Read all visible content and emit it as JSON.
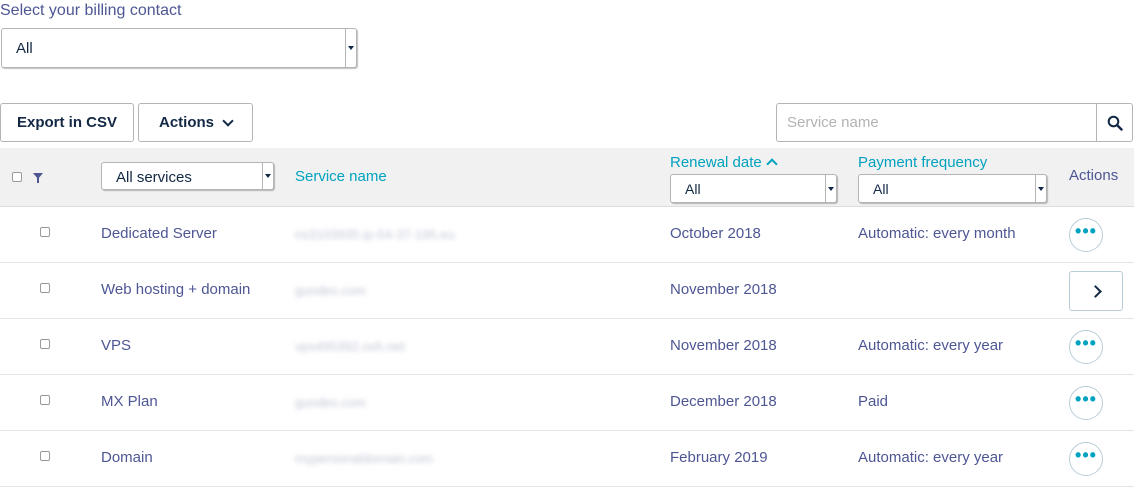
{
  "billing": {
    "label": "Select your billing contact",
    "selected": "All"
  },
  "toolbar": {
    "export_label": "Export in CSV",
    "actions_label": "Actions"
  },
  "search": {
    "placeholder": "Service name"
  },
  "table": {
    "headers": {
      "services_filter": "All services",
      "service_name": "Service name",
      "renewal_date": "Renewal date",
      "renewal_filter": "All",
      "payment_frequency": "Payment frequency",
      "frequency_filter": "All",
      "actions": "Actions"
    },
    "rows": [
      {
        "type": "Dedicated Server",
        "name": "ns3103935.ip-54-37-195.eu",
        "renewal": "October 2018",
        "frequency": "Automatic: every month",
        "action": "more"
      },
      {
        "type": "Web hosting + domain",
        "name": "gundes.com",
        "renewal": "November 2018",
        "frequency": "",
        "action": "open"
      },
      {
        "type": "VPS",
        "name": "vps495392.ovh.net",
        "renewal": "November 2018",
        "frequency": "Automatic: every year",
        "action": "more"
      },
      {
        "type": "MX Plan",
        "name": "gundes.com",
        "renewal": "December 2018",
        "frequency": "Paid",
        "action": "more"
      },
      {
        "type": "Domain",
        "name": "mypersonaldomain.com",
        "renewal": "February 2019",
        "frequency": "Automatic: every year",
        "action": "more"
      }
    ]
  },
  "colors": {
    "link": "#00a2bf",
    "text": "#4d5693",
    "dark": "#122844",
    "header_bg": "#f1f1f1"
  },
  "icons": {
    "search": "search-icon",
    "filter": "filter-icon",
    "more": "more-dots-icon",
    "open": "chevron-right-icon"
  }
}
